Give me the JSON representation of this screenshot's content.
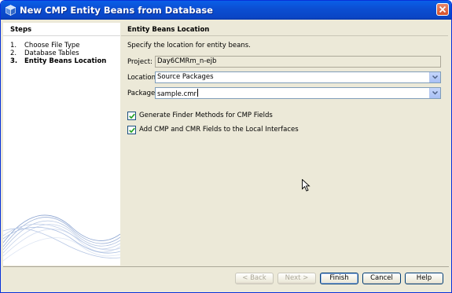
{
  "window": {
    "title": "New CMP Entity Beans from Database"
  },
  "steps": {
    "heading": "Steps",
    "items": [
      {
        "number": "1.",
        "label": "Choose File Type",
        "current": false
      },
      {
        "number": "2.",
        "label": "Database Tables",
        "current": false
      },
      {
        "number": "3.",
        "label": "Entity Beans Location",
        "current": true
      }
    ]
  },
  "panel": {
    "heading": "Entity Beans Location",
    "instructions": "Specify the location for entity beans.",
    "project_label": "Project:",
    "project_value": "Day6CMRm_n-ejb",
    "location_label": "Location:",
    "location_value": "Source Packages",
    "package_label": "Package:",
    "package_value": "sample.cmr",
    "checkbox_finder": {
      "label": "Generate Finder Methods for CMP Fields",
      "checked": true
    },
    "checkbox_local": {
      "label": "Add CMP and CMR Fields to the Local Interfaces",
      "checked": true
    }
  },
  "buttons": {
    "back": "< Back",
    "next": "Next >",
    "finish": "Finish",
    "cancel": "Cancel",
    "help": "Help"
  },
  "colors": {
    "titlebar": "#0a4fd3",
    "dialog_bg": "#ece9d8",
    "field_border": "#7f9db9",
    "checkbox_check": "#21a121"
  }
}
